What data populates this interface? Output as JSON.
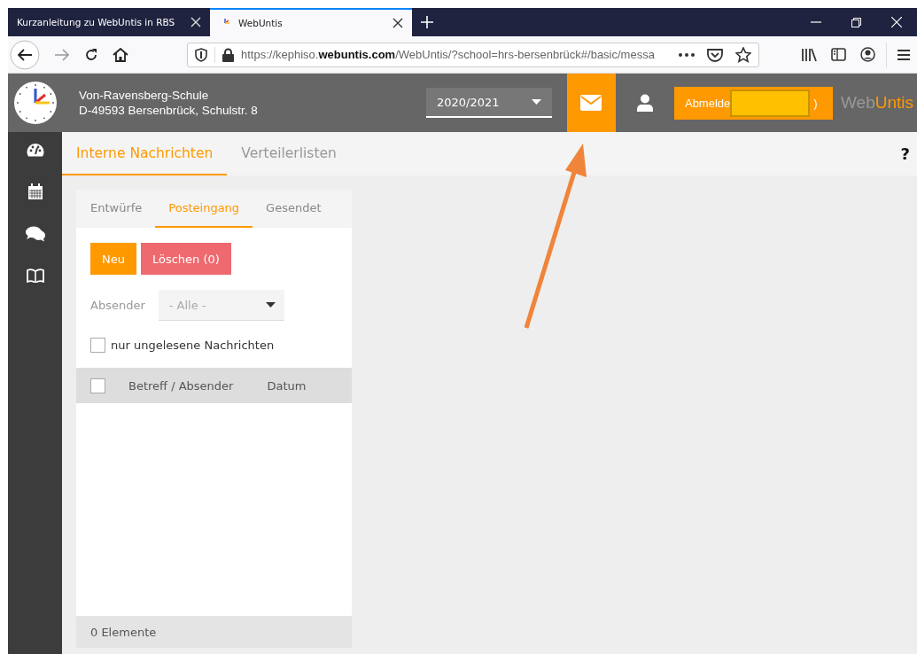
{
  "browser": {
    "tabs": [
      {
        "title": "Kurzanleitung zu WebUntis in RBS",
        "selected": false
      },
      {
        "title": "WebUntis",
        "selected": true
      }
    ],
    "url": {
      "prefix": "https://kephiso.",
      "domain": "webuntis.com",
      "rest": "/WebUntis/?school=hrs-bersenbrück#/basic/messa"
    }
  },
  "header": {
    "school_name": "Von-Ravensberg-Schule",
    "school_address": "D-49593 Bersenbrück, Schulstr. 8",
    "school_year": "2020/2021",
    "messages_active": true,
    "logout_label": "Abmelde",
    "logout_label_end": ")",
    "brand_first": "Web",
    "brand_second": "Untis"
  },
  "sidebar": {
    "items": [
      {
        "kind": "dashboard",
        "selected": false
      },
      {
        "kind": "calendar",
        "selected": false
      },
      {
        "kind": "chat",
        "selected": false
      },
      {
        "kind": "book",
        "selected": false
      }
    ]
  },
  "main_tabs": [
    {
      "label": "Interne Nachrichten",
      "selected": true
    },
    {
      "label": "Verteilerlisten",
      "selected": false
    }
  ],
  "help_label": "?",
  "panel": {
    "tabs": [
      {
        "label": "Entwürfe",
        "selected": false
      },
      {
        "label": "Posteingang",
        "selected": true
      },
      {
        "label": "Gesendet",
        "selected": false
      }
    ],
    "buttons": [
      {
        "label": "Neu",
        "kind": "primary"
      },
      {
        "label": "Löschen (0)",
        "kind": "danger"
      }
    ],
    "sender_filter": {
      "label": "Absender",
      "value": "- Alle -"
    },
    "unread_only": {
      "label": "nur ungelesene Nachrichten",
      "checked": false
    },
    "table": {
      "select_all_checked": false,
      "columns": [
        "Betreff / Absender",
        "Datum"
      ]
    },
    "footer": "0 Elemente"
  }
}
